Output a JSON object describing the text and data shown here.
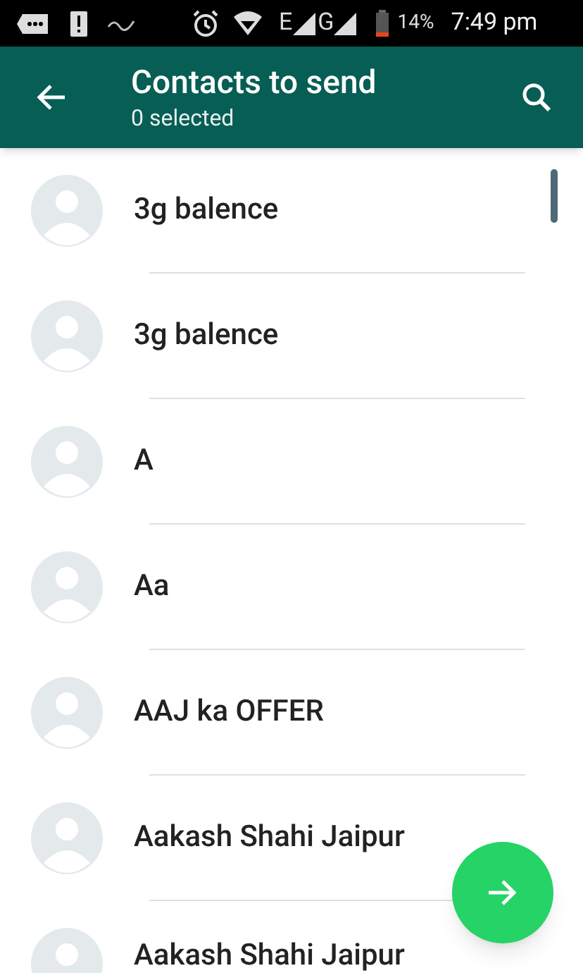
{
  "status_bar": {
    "network_1": "E",
    "network_2": "G",
    "battery": "14%",
    "time": "7:49 pm"
  },
  "header": {
    "title": "Contacts to send",
    "subtitle": "0 selected"
  },
  "contacts": [
    {
      "name": "3g balence"
    },
    {
      "name": "3g balence"
    },
    {
      "name": "A"
    },
    {
      "name": "Aa"
    },
    {
      "name": "AAJ ka OFFER"
    },
    {
      "name": "Aakash Shahi Jaipur"
    },
    {
      "name": "Aakash Shahi Jaipur"
    }
  ]
}
